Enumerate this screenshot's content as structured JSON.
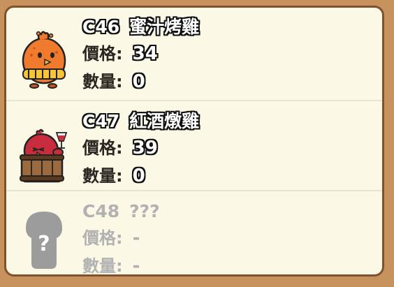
{
  "items": [
    {
      "code": "C46",
      "name": "蜜汁烤雞",
      "price_label": "價格:",
      "price": "34",
      "qty_label": "數量:",
      "qty": "0",
      "icon": "honey-roast-chicken-icon",
      "locked": false
    },
    {
      "code": "C47",
      "name": "紅酒燉雞",
      "price_label": "價格:",
      "price": "39",
      "qty_label": "數量:",
      "qty": "0",
      "icon": "red-wine-chicken-icon",
      "locked": false
    },
    {
      "code": "C48",
      "name": "???",
      "price_label": "價格:",
      "price": "-",
      "qty_label": "數量:",
      "qty": "-",
      "icon": "locked-mystery-icon",
      "locked": true
    }
  ],
  "colors": {
    "background": "#c8925f",
    "panel": "#fbf9e6",
    "border": "#7f522e",
    "locked_text": "#b2b2b2"
  }
}
